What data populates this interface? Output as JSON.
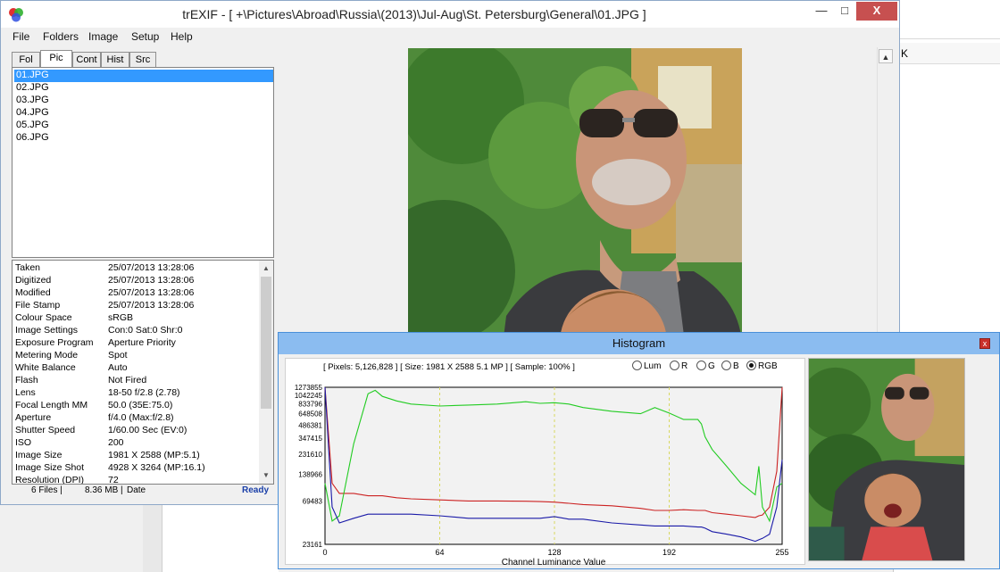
{
  "window": {
    "title": "trEXIF - [ +\\Pictures\\Abroad\\Russia\\(2013)\\Jul-Aug\\St. Petersburg\\General\\01.JPG ]",
    "minimize_glyph": "—",
    "maximize_glyph": "□",
    "close_glyph": "X"
  },
  "background_window": {
    "header_text": "K"
  },
  "menu": [
    "File",
    "Folders",
    "Image",
    "Setup",
    "Help"
  ],
  "tabs": [
    {
      "label": "Fol",
      "active": false
    },
    {
      "label": "Pic",
      "active": true
    },
    {
      "label": "Cont",
      "active": false
    },
    {
      "label": "Hist",
      "active": false
    },
    {
      "label": "Src",
      "active": false
    }
  ],
  "files": [
    "01.JPG",
    "02.JPG",
    "03.JPG",
    "04.JPG",
    "05.JPG",
    "06.JPG"
  ],
  "selected_file_index": 0,
  "exif": [
    {
      "k": "Taken",
      "v": "25/07/2013 13:28:06"
    },
    {
      "k": "Digitized",
      "v": "25/07/2013 13:28:06"
    },
    {
      "k": "Modified",
      "v": "25/07/2013 13:28:06"
    },
    {
      "k": "File Stamp",
      "v": "25/07/2013 13:28:06"
    },
    {
      "k": "Colour Space",
      "v": "sRGB"
    },
    {
      "k": "Image Settings",
      "v": "Con:0  Sat:0  Shr:0"
    },
    {
      "k": "Exposure Program",
      "v": "Aperture Priority"
    },
    {
      "k": "Metering Mode",
      "v": "Spot"
    },
    {
      "k": "White Balance",
      "v": "Auto"
    },
    {
      "k": "Flash",
      "v": "Not Fired"
    },
    {
      "k": "Lens",
      "v": "18-50 f/2.8 (2.78)"
    },
    {
      "k": "Focal Length  MM",
      "v": "50.0 (35E:75.0)"
    },
    {
      "k": "Aperture",
      "v": "f/4.0 (Max:f/2.8)"
    },
    {
      "k": "Shutter Speed",
      "v": "1/60.00 Sec (EV:0)"
    },
    {
      "k": "ISO",
      "v": "200"
    },
    {
      "k": "Image Size",
      "v": "1981 X 2588 (MP:5.1)"
    },
    {
      "k": "Image Size Shot",
      "v": "4928 X 3264 (MP:16.1)"
    },
    {
      "k": "Resolution (DPI)",
      "v": "72"
    }
  ],
  "status": {
    "files": "6 Files |",
    "size": "8.36 MB |",
    "sort": "Date",
    "state": "Ready"
  },
  "histogram": {
    "title": "Histogram",
    "close_glyph": "x",
    "info": "[ Pixels: 5,126,828 ]   [ Size: 1981 X 2588  5.1 MP ]   [ Sample: 100% ]",
    "radios": [
      {
        "label": "Lum",
        "selected": false
      },
      {
        "label": "R",
        "selected": false
      },
      {
        "label": "G",
        "selected": false
      },
      {
        "label": "B",
        "selected": false
      },
      {
        "label": "RGB",
        "selected": true
      }
    ],
    "colors": {
      "red": "#cc2222",
      "green": "#22cc22",
      "blue": "#1a1aa8",
      "grid": "#d8d860"
    }
  },
  "chart_data": {
    "type": "line",
    "xlabel": "Channel Luminance Value",
    "ylabel": "",
    "title": "",
    "xlim": [
      0,
      255
    ],
    "ylim": [
      23161,
      1273855
    ],
    "x_ticks": [
      "0",
      "64",
      "128",
      "192",
      "255"
    ],
    "y_ticks": [
      "1273855",
      "1042245",
      "833796",
      "648508",
      "486381",
      "347415",
      "231610",
      "138966",
      "69483",
      "23161"
    ],
    "x": [
      0,
      4,
      8,
      16,
      24,
      28,
      32,
      40,
      48,
      64,
      80,
      96,
      112,
      120,
      128,
      136,
      144,
      160,
      176,
      184,
      192,
      200,
      208,
      210,
      212,
      216,
      224,
      232,
      240,
      242,
      244,
      248,
      252,
      255
    ],
    "series": [
      {
        "name": "R",
        "color": "red",
        "values": [
          1273855,
          110000,
          85000,
          85000,
          80000,
          80000,
          80000,
          76000,
          74000,
          72000,
          70000,
          70000,
          69483,
          69000,
          68000,
          66000,
          64000,
          62000,
          58000,
          55000,
          55000,
          56000,
          55000,
          55000,
          55000,
          52000,
          50000,
          48000,
          46000,
          48000,
          49000,
          60000,
          150000,
          1273855
        ]
      },
      {
        "name": "G",
        "color": "green",
        "values": [
          110000,
          42000,
          48000,
          300000,
          1080000,
          1180000,
          1010000,
          900000,
          830000,
          790000,
          810000,
          830000,
          880000,
          845000,
          860000,
          830000,
          760000,
          690000,
          650000,
          760000,
          660000,
          560000,
          560000,
          500000,
          360000,
          260000,
          170000,
          110000,
          82000,
          170000,
          60000,
          42000,
          100000,
          110000
        ]
      },
      {
        "name": "B",
        "color": "blue",
        "values": [
          1273855,
          60000,
          40000,
          45000,
          50000,
          50000,
          50000,
          50000,
          50000,
          48000,
          45000,
          45000,
          45000,
          45000,
          47000,
          44000,
          44000,
          40000,
          38000,
          37000,
          37000,
          37000,
          36000,
          36000,
          35000,
          32000,
          30000,
          28000,
          25000,
          26000,
          27000,
          30000,
          60000,
          200000
        ]
      }
    ]
  }
}
